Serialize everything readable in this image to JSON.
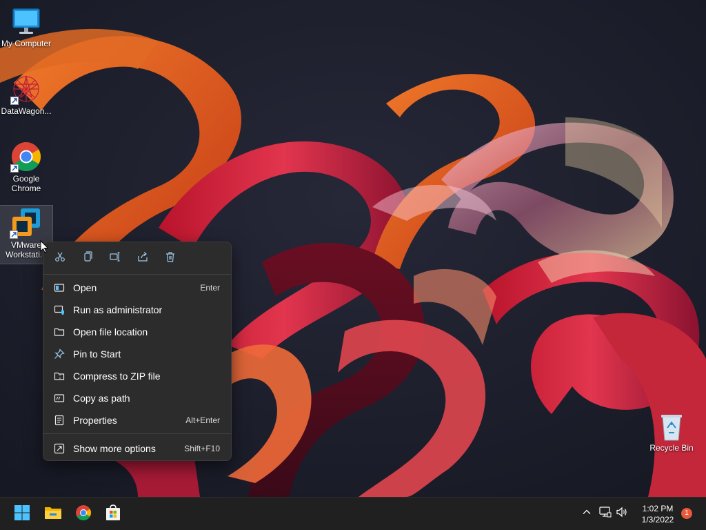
{
  "desktop": {
    "icons": [
      {
        "label": "My Computer",
        "icon": "monitor-icon"
      },
      {
        "label": "DataWagon...",
        "icon": "datawagon-icon"
      },
      {
        "label": "Google Chrome",
        "icon": "chrome-icon"
      },
      {
        "label": "VMware Workstati...",
        "icon": "vmware-icon"
      },
      {
        "label": "Recycle Bin",
        "icon": "recycle-bin-icon"
      }
    ]
  },
  "context_menu": {
    "toolbar": [
      {
        "name": "cut",
        "icon": "scissors-icon"
      },
      {
        "name": "copy",
        "icon": "copy-icon"
      },
      {
        "name": "rename",
        "icon": "rename-icon"
      },
      {
        "name": "share",
        "icon": "share-icon"
      },
      {
        "name": "delete",
        "icon": "trash-icon"
      }
    ],
    "items": [
      {
        "label": "Open",
        "shortcut": "Enter",
        "icon": "open-icon"
      },
      {
        "label": "Run as administrator",
        "shortcut": "",
        "icon": "shield-icon"
      },
      {
        "label": "Open file location",
        "shortcut": "",
        "icon": "folder-icon"
      },
      {
        "label": "Pin to Start",
        "shortcut": "",
        "icon": "pin-icon"
      },
      {
        "label": "Compress to ZIP file",
        "shortcut": "",
        "icon": "zip-folder-icon"
      },
      {
        "label": "Copy as path",
        "shortcut": "",
        "icon": "path-icon"
      },
      {
        "label": "Properties",
        "shortcut": "Alt+Enter",
        "icon": "properties-icon"
      },
      {
        "label": "Show more options",
        "shortcut": "Shift+F10",
        "icon": "more-options-icon"
      }
    ]
  },
  "taskbar": {
    "apps": [
      "start-icon",
      "file-explorer-icon",
      "chrome-icon",
      "store-icon"
    ],
    "tray": [
      "chevron-up-icon",
      "network-icon",
      "volume-icon"
    ],
    "time": "1:02 PM",
    "date": "1/3/2022",
    "notification_count": "1"
  },
  "colors": {
    "menu_bg": "#2c2c2c",
    "taskbar_bg": "#202020",
    "accent": "#4cc2ff",
    "badge": "#e8583b"
  }
}
